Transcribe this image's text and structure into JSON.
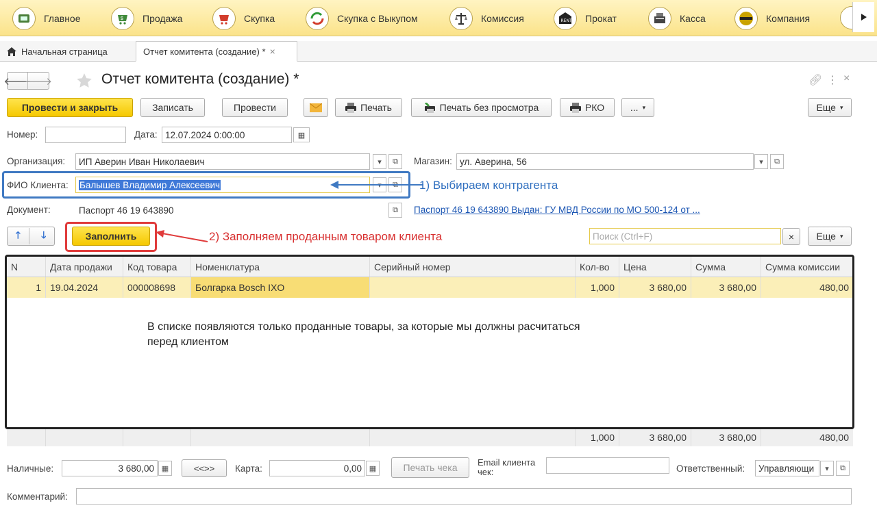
{
  "sections": [
    {
      "label": "Главное",
      "icon": "home-icon"
    },
    {
      "label": "Продажа",
      "icon": "cart-icon"
    },
    {
      "label": "Скупка",
      "icon": "basket-icon"
    },
    {
      "label": "Скупка с Выкупом",
      "icon": "cycle-icon"
    },
    {
      "label": "Комиссия",
      "icon": "scales-icon"
    },
    {
      "label": "Прокат",
      "icon": "rent-icon"
    },
    {
      "label": "Касса",
      "icon": "cash-register-icon"
    },
    {
      "label": "Компания",
      "icon": "company-icon"
    }
  ],
  "tabs": {
    "home": "Начальная страница",
    "active": "Отчет комитента (создание) *"
  },
  "form": {
    "title": "Отчет комитента (создание) *",
    "buttons": {
      "post_close": "Провести и закрыть",
      "save": "Записать",
      "post": "Провести",
      "print": "Печать",
      "print_no_preview": "Печать без просмотра",
      "rko": "РКО",
      "more_dots": "...",
      "more": "Еще"
    },
    "number_label": "Номер:",
    "number_value": "",
    "date_label": "Дата:",
    "date_value": "12.07.2024  0:00:00",
    "org_label": "Организация:",
    "org_value": "ИП Аверин Иван Николаевич",
    "shop_label": "Магазин:",
    "shop_value": "ул. Аверина, 56",
    "client_label": "ФИО Клиента:",
    "client_value": "Балышев Владимир Алексеевич",
    "doc_label": "Документ:",
    "doc_value": "Паспорт 46 19 643890",
    "doc_link": "Паспорт 46 19 643890 Выдан: ГУ МВД России по МО 500-124 от ..."
  },
  "annotations": {
    "step1": "1) Выбираем контрагента",
    "step2": "2) Заполняем проданным товаром клиента",
    "note_line1": "В списке появляются только проданные товары, за которые мы должны расчитаться",
    "note_line2": "перед клиентом"
  },
  "table_toolbar": {
    "fill": "Заполнить",
    "search_placeholder": "Поиск (Ctrl+F)",
    "more": "Еще",
    "clear": "×"
  },
  "table": {
    "columns": [
      "N",
      "Дата продажи",
      "Код товара",
      "Номенклатура",
      "Серийный номер",
      "Кол-во",
      "Цена",
      "Сумма",
      "Сумма комиссии"
    ],
    "rows": [
      [
        "1",
        "19.04.2024",
        "000008698",
        "Болгарка Bosch IXO",
        "",
        "1,000",
        "3 680,00",
        "3 680,00",
        "480,00"
      ]
    ],
    "totals": {
      "qty": "1,000",
      "price": "3 680,00",
      "sum": "3 680,00",
      "commission": "480,00"
    }
  },
  "footer": {
    "cash_label": "Наличные:",
    "cash_value": "3 680,00",
    "swap": "<<>>",
    "card_label": "Карта:",
    "card_value": "0,00",
    "print_receipt": "Печать чека",
    "email_label_1": "Email клиента",
    "email_label_2": "чек:",
    "email_value": "",
    "responsible_label": "Ответственный:",
    "responsible_value": "Управляющи",
    "comment_label": "Комментарий:",
    "comment_value": ""
  }
}
